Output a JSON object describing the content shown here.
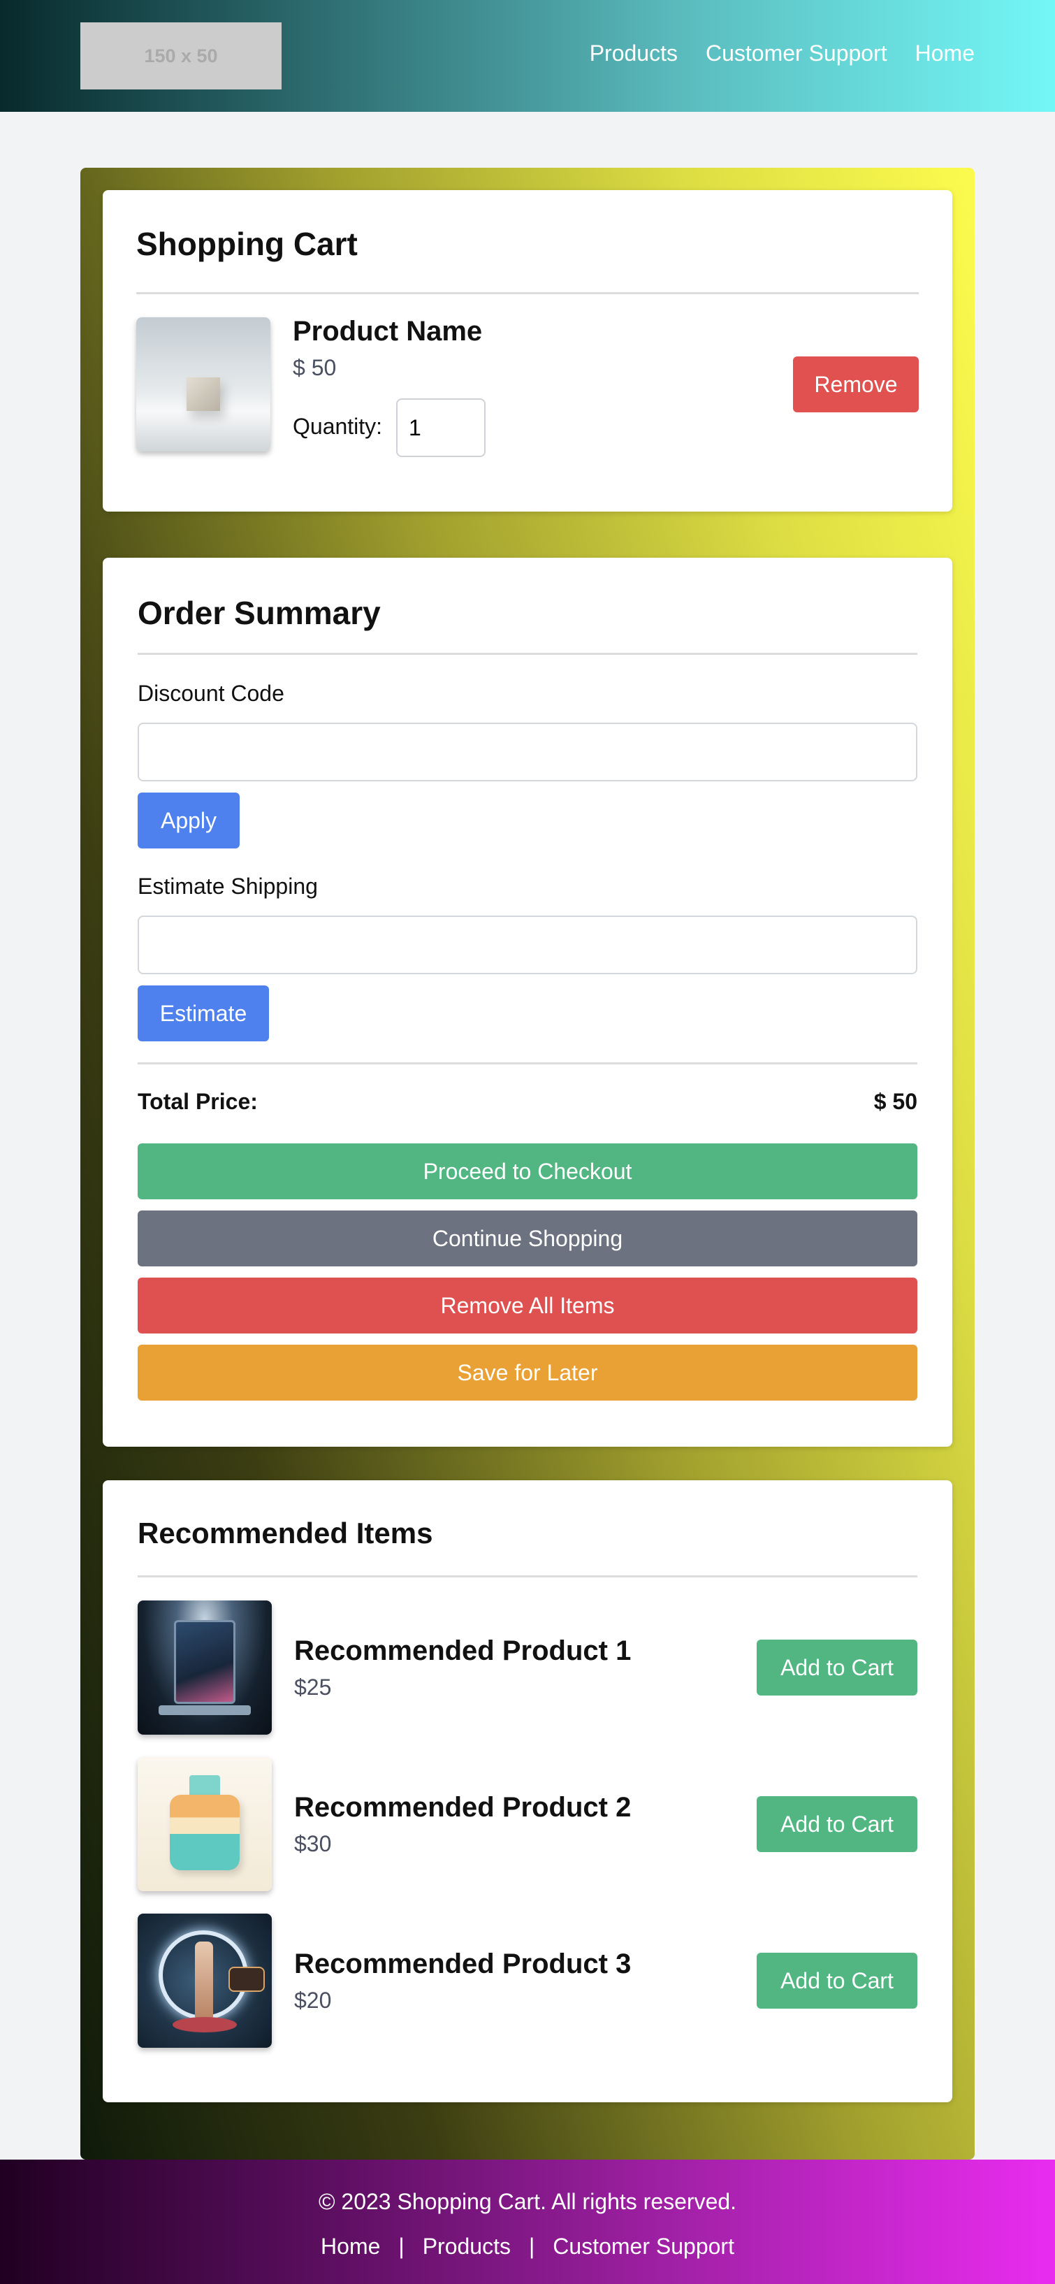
{
  "header": {
    "logo_text": "150 x 50",
    "nav": [
      "Products",
      "Customer Support",
      "Home"
    ]
  },
  "cart": {
    "title": "Shopping Cart",
    "item": {
      "name": "Product Name",
      "price": "$ 50",
      "quantity_label": "Quantity:",
      "quantity_value": "1",
      "remove_label": "Remove"
    }
  },
  "summary": {
    "title": "Order Summary",
    "discount_label": "Discount Code",
    "discount_value": "",
    "apply_label": "Apply",
    "shipping_label": "Estimate Shipping",
    "shipping_value": "",
    "estimate_label": "Estimate",
    "total_label": "Total Price:",
    "total_value": "$ 50",
    "actions": {
      "checkout": "Proceed to Checkout",
      "continue": "Continue Shopping",
      "remove_all": "Remove All Items",
      "save_later": "Save for Later"
    }
  },
  "recommended": {
    "title": "Recommended Items",
    "items": [
      {
        "name": "Recommended Product 1",
        "price": "$25",
        "button": "Add to Cart"
      },
      {
        "name": "Recommended Product 2",
        "price": "$30",
        "button": "Add to Cart"
      },
      {
        "name": "Recommended Product 3",
        "price": "$20",
        "button": "Add to Cart"
      }
    ]
  },
  "footer": {
    "copyright": "© 2023 Shopping Cart. All rights reserved.",
    "links": [
      "Home",
      "Products",
      "Customer Support"
    ],
    "separator": "|"
  },
  "colors": {
    "success": "#52b683",
    "danger": "#e05150",
    "primary": "#4f81ee",
    "secondary": "#6c727f",
    "warning": "#e9a035"
  }
}
